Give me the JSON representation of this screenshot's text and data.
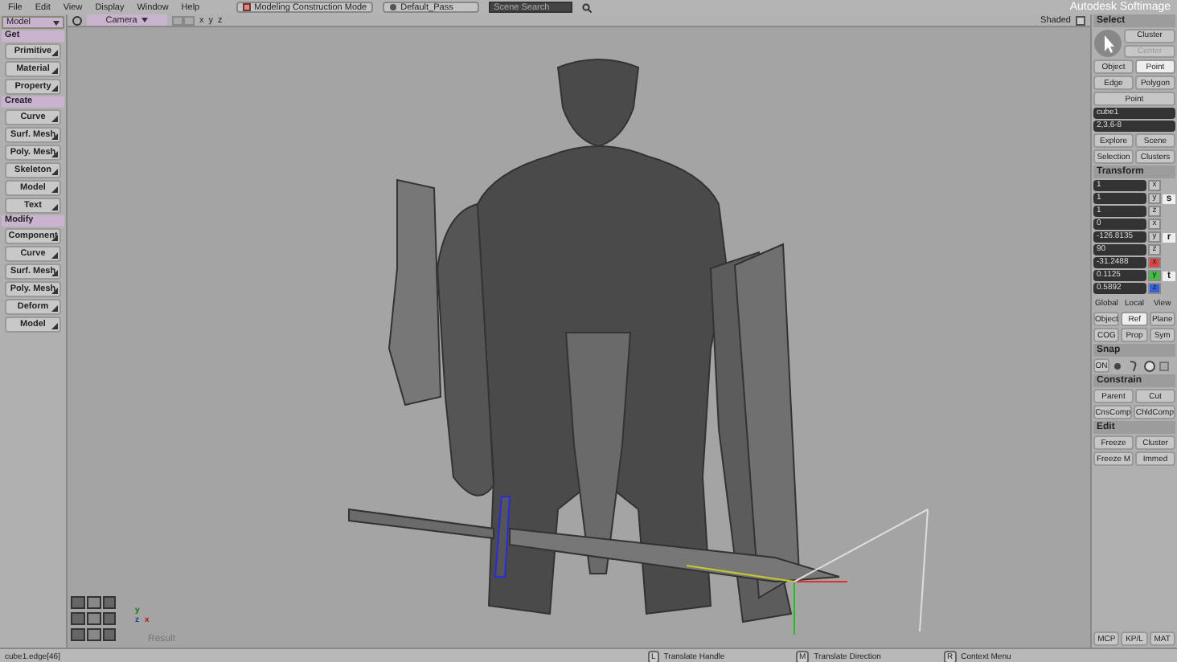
{
  "menu": [
    "File",
    "Edit",
    "View",
    "Display",
    "Window",
    "Help"
  ],
  "mode_dropdown": {
    "value": "Modeling Construction Mode"
  },
  "pass_dropdown": {
    "value": "Default_Pass"
  },
  "scene_search": {
    "placeholder": "Scene Search"
  },
  "app_title": "Autodesk Softimage",
  "module_dropdown": {
    "value": "Model"
  },
  "left_panel": {
    "sections": [
      {
        "title": "Get",
        "buttons": [
          "Primitive",
          "Material",
          "Property"
        ]
      },
      {
        "title": "Create",
        "buttons": [
          "Curve",
          "Surf. Mesh",
          "Poly. Mesh",
          "Skeleton",
          "Model",
          "Text"
        ]
      },
      {
        "title": "Modify",
        "buttons": [
          "Component",
          "Curve",
          "Surf. Mesh",
          "Poly. Mesh",
          "Deform",
          "Model"
        ]
      }
    ]
  },
  "viewport": {
    "camera": "Camera",
    "axis_buttons": [
      "x",
      "y",
      "z"
    ],
    "display_mode": "Shaded",
    "label": "Result",
    "axis_labels": [
      "y",
      "z",
      "x"
    ]
  },
  "right_panel": {
    "select": {
      "title": "Select",
      "buttons": [
        {
          "label": "Cluster",
          "disabled": false
        },
        {
          "label": "Center",
          "disabled": true
        }
      ],
      "filters": [
        {
          "label": "Object",
          "selected": false
        },
        {
          "label": "Point",
          "selected": true
        },
        {
          "label": "Edge",
          "selected": false
        },
        {
          "label": "Polygon",
          "selected": false
        }
      ],
      "filter_dropdown": "Point",
      "object_name": "cube1",
      "component_field": "2,3,6-8",
      "actions": [
        "Explore",
        "Scene",
        "Selection",
        "Clusters"
      ]
    },
    "transform": {
      "title": "Transform",
      "groups": [
        {
          "tool": "s",
          "fields": [
            {
              "axis": "x",
              "value": "1"
            },
            {
              "axis": "y",
              "value": "1"
            },
            {
              "axis": "z",
              "value": "1"
            }
          ]
        },
        {
          "tool": "r",
          "fields": [
            {
              "axis": "x",
              "value": "0"
            },
            {
              "axis": "y",
              "value": "-126.8135"
            },
            {
              "axis": "z",
              "value": "90"
            }
          ]
        },
        {
          "tool": "t",
          "fields": [
            {
              "axis": "x",
              "value": "-31.2488",
              "color": "#e04040"
            },
            {
              "axis": "y",
              "value": "0.1125",
              "color": "#40c040"
            },
            {
              "axis": "z",
              "value": "0.5892",
              "color": "#3060e0"
            }
          ]
        }
      ],
      "spaces": [
        "Global",
        "Local",
        "View"
      ],
      "references": [
        {
          "label": "Object",
          "selected": false
        },
        {
          "label": "Ref",
          "selected": true
        },
        {
          "label": "Plane",
          "selected": false
        }
      ],
      "options": [
        "COG",
        "Prop",
        "Sym"
      ]
    },
    "snap": {
      "title": "Snap",
      "on_label": "ON"
    },
    "constrain": {
      "title": "Constrain",
      "buttons": [
        "Parent",
        "Cut",
        "CnsComp",
        "ChldComp"
      ]
    },
    "edit": {
      "title": "Edit",
      "buttons": [
        "Freeze",
        "Cluster",
        "Freeze M",
        "Immed"
      ]
    },
    "tabs": [
      "MCP",
      "KP/L",
      "MAT"
    ]
  },
  "status_bar": {
    "selection": "cube1.edge[46]",
    "hints": [
      {
        "button": "L",
        "text": "Translate Handle"
      },
      {
        "button": "M",
        "text": "Translate Direction"
      },
      {
        "button": "R",
        "text": "Context Menu"
      }
    ]
  }
}
